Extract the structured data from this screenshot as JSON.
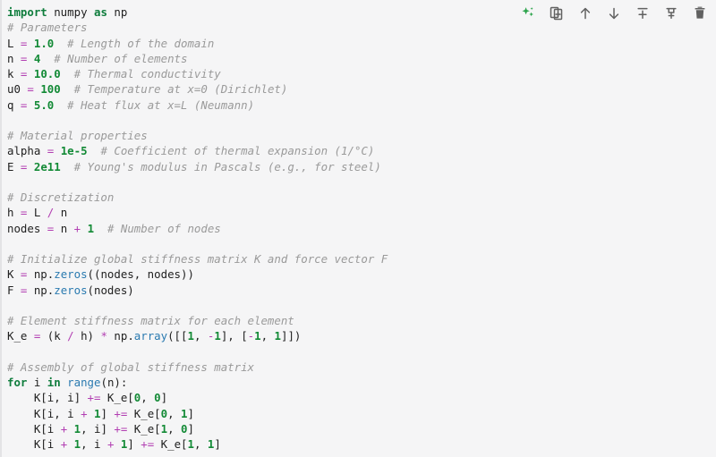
{
  "cell": {
    "type": "code-cell",
    "background_color": "#f5f5f6",
    "accent_bar_color": "#e3e3e5"
  },
  "toolbar": {
    "buttons": [
      {
        "name": "ai-assist-icon",
        "label": "Generate with AI",
        "color": "#2aa34a"
      },
      {
        "name": "duplicate-cell-icon",
        "label": "Duplicate cell",
        "color": "#616161"
      },
      {
        "name": "move-cell-up-icon",
        "label": "Move cell up",
        "color": "#616161"
      },
      {
        "name": "move-cell-down-icon",
        "label": "Move cell down",
        "color": "#616161"
      },
      {
        "name": "insert-cell-above-icon",
        "label": "Insert cell above",
        "color": "#616161"
      },
      {
        "name": "insert-cell-below-icon",
        "label": "Insert cell below",
        "color": "#616161"
      },
      {
        "name": "delete-cell-icon",
        "label": "Delete cell",
        "color": "#616161"
      }
    ]
  },
  "code": {
    "language": "python",
    "lines": [
      [
        {
          "t": "kw",
          "v": "import"
        },
        {
          "t": "nm",
          "v": " numpy "
        },
        {
          "t": "kw",
          "v": "as"
        },
        {
          "t": "nm",
          "v": " np"
        }
      ],
      [
        {
          "t": "com",
          "v": "# Parameters"
        }
      ],
      [
        {
          "t": "nm",
          "v": "L "
        },
        {
          "t": "op",
          "v": "="
        },
        {
          "t": "nm",
          "v": " "
        },
        {
          "t": "num",
          "v": "1.0"
        },
        {
          "t": "nm",
          "v": "  "
        },
        {
          "t": "com",
          "v": "# Length of the domain"
        }
      ],
      [
        {
          "t": "nm",
          "v": "n "
        },
        {
          "t": "op",
          "v": "="
        },
        {
          "t": "nm",
          "v": " "
        },
        {
          "t": "num",
          "v": "4"
        },
        {
          "t": "nm",
          "v": "  "
        },
        {
          "t": "com",
          "v": "# Number of elements"
        }
      ],
      [
        {
          "t": "nm",
          "v": "k "
        },
        {
          "t": "op",
          "v": "="
        },
        {
          "t": "nm",
          "v": " "
        },
        {
          "t": "num",
          "v": "10.0"
        },
        {
          "t": "nm",
          "v": "  "
        },
        {
          "t": "com",
          "v": "# Thermal conductivity"
        }
      ],
      [
        {
          "t": "nm",
          "v": "u0 "
        },
        {
          "t": "op",
          "v": "="
        },
        {
          "t": "nm",
          "v": " "
        },
        {
          "t": "num",
          "v": "100"
        },
        {
          "t": "nm",
          "v": "  "
        },
        {
          "t": "com",
          "v": "# Temperature at x=0 (Dirichlet)"
        }
      ],
      [
        {
          "t": "nm",
          "v": "q "
        },
        {
          "t": "op",
          "v": "="
        },
        {
          "t": "nm",
          "v": " "
        },
        {
          "t": "num",
          "v": "5.0"
        },
        {
          "t": "nm",
          "v": "  "
        },
        {
          "t": "com",
          "v": "# Heat flux at x=L (Neumann)"
        }
      ],
      [],
      [
        {
          "t": "com",
          "v": "# Material properties"
        }
      ],
      [
        {
          "t": "nm",
          "v": "alpha "
        },
        {
          "t": "op",
          "v": "="
        },
        {
          "t": "nm",
          "v": " "
        },
        {
          "t": "num",
          "v": "1e-5"
        },
        {
          "t": "nm",
          "v": "  "
        },
        {
          "t": "com",
          "v": "# Coefficient of thermal expansion (1/°C)"
        }
      ],
      [
        {
          "t": "nm",
          "v": "E "
        },
        {
          "t": "op",
          "v": "="
        },
        {
          "t": "nm",
          "v": " "
        },
        {
          "t": "num",
          "v": "2e11"
        },
        {
          "t": "nm",
          "v": "  "
        },
        {
          "t": "com",
          "v": "# Young's modulus in Pascals (e.g., for steel)"
        }
      ],
      [],
      [
        {
          "t": "com",
          "v": "# Discretization"
        }
      ],
      [
        {
          "t": "nm",
          "v": "h "
        },
        {
          "t": "op",
          "v": "="
        },
        {
          "t": "nm",
          "v": " L "
        },
        {
          "t": "op",
          "v": "/"
        },
        {
          "t": "nm",
          "v": " n"
        }
      ],
      [
        {
          "t": "nm",
          "v": "nodes "
        },
        {
          "t": "op",
          "v": "="
        },
        {
          "t": "nm",
          "v": " n "
        },
        {
          "t": "op",
          "v": "+"
        },
        {
          "t": "nm",
          "v": " "
        },
        {
          "t": "num",
          "v": "1"
        },
        {
          "t": "nm",
          "v": "  "
        },
        {
          "t": "com",
          "v": "# Number of nodes"
        }
      ],
      [],
      [
        {
          "t": "com",
          "v": "# Initialize global stiffness matrix K and force vector F"
        }
      ],
      [
        {
          "t": "nm",
          "v": "K "
        },
        {
          "t": "op",
          "v": "="
        },
        {
          "t": "nm",
          "v": " np."
        },
        {
          "t": "fn",
          "v": "zeros"
        },
        {
          "t": "nm",
          "v": "((nodes, nodes))"
        }
      ],
      [
        {
          "t": "nm",
          "v": "F "
        },
        {
          "t": "op",
          "v": "="
        },
        {
          "t": "nm",
          "v": " np."
        },
        {
          "t": "fn",
          "v": "zeros"
        },
        {
          "t": "nm",
          "v": "(nodes)"
        }
      ],
      [],
      [
        {
          "t": "com",
          "v": "# Element stiffness matrix for each element"
        }
      ],
      [
        {
          "t": "nm",
          "v": "K_e "
        },
        {
          "t": "op",
          "v": "="
        },
        {
          "t": "nm",
          "v": " (k "
        },
        {
          "t": "op",
          "v": "/"
        },
        {
          "t": "nm",
          "v": " h) "
        },
        {
          "t": "op",
          "v": "*"
        },
        {
          "t": "nm",
          "v": " np."
        },
        {
          "t": "fn",
          "v": "array"
        },
        {
          "t": "nm",
          "v": "([["
        },
        {
          "t": "num",
          "v": "1"
        },
        {
          "t": "nm",
          "v": ", "
        },
        {
          "t": "op",
          "v": "-"
        },
        {
          "t": "num",
          "v": "1"
        },
        {
          "t": "nm",
          "v": "], ["
        },
        {
          "t": "op",
          "v": "-"
        },
        {
          "t": "num",
          "v": "1"
        },
        {
          "t": "nm",
          "v": ", "
        },
        {
          "t": "num",
          "v": "1"
        },
        {
          "t": "nm",
          "v": "]])"
        }
      ],
      [],
      [
        {
          "t": "com",
          "v": "# Assembly of global stiffness matrix"
        }
      ],
      [
        {
          "t": "kw",
          "v": "for"
        },
        {
          "t": "nm",
          "v": " i "
        },
        {
          "t": "kw",
          "v": "in"
        },
        {
          "t": "nm",
          "v": " "
        },
        {
          "t": "fn",
          "v": "range"
        },
        {
          "t": "nm",
          "v": "(n):"
        }
      ],
      [
        {
          "t": "nm",
          "v": "    K[i, i] "
        },
        {
          "t": "op",
          "v": "+="
        },
        {
          "t": "nm",
          "v": " K_e["
        },
        {
          "t": "num",
          "v": "0"
        },
        {
          "t": "nm",
          "v": ", "
        },
        {
          "t": "num",
          "v": "0"
        },
        {
          "t": "nm",
          "v": "]"
        }
      ],
      [
        {
          "t": "nm",
          "v": "    K[i, i "
        },
        {
          "t": "op",
          "v": "+"
        },
        {
          "t": "nm",
          "v": " "
        },
        {
          "t": "num",
          "v": "1"
        },
        {
          "t": "nm",
          "v": "] "
        },
        {
          "t": "op",
          "v": "+="
        },
        {
          "t": "nm",
          "v": " K_e["
        },
        {
          "t": "num",
          "v": "0"
        },
        {
          "t": "nm",
          "v": ", "
        },
        {
          "t": "num",
          "v": "1"
        },
        {
          "t": "nm",
          "v": "]"
        }
      ],
      [
        {
          "t": "nm",
          "v": "    K[i "
        },
        {
          "t": "op",
          "v": "+"
        },
        {
          "t": "nm",
          "v": " "
        },
        {
          "t": "num",
          "v": "1"
        },
        {
          "t": "nm",
          "v": ", i] "
        },
        {
          "t": "op",
          "v": "+="
        },
        {
          "t": "nm",
          "v": " K_e["
        },
        {
          "t": "num",
          "v": "1"
        },
        {
          "t": "nm",
          "v": ", "
        },
        {
          "t": "num",
          "v": "0"
        },
        {
          "t": "nm",
          "v": "]"
        }
      ],
      [
        {
          "t": "nm",
          "v": "    K[i "
        },
        {
          "t": "op",
          "v": "+"
        },
        {
          "t": "nm",
          "v": " "
        },
        {
          "t": "num",
          "v": "1"
        },
        {
          "t": "nm",
          "v": ", i "
        },
        {
          "t": "op",
          "v": "+"
        },
        {
          "t": "nm",
          "v": " "
        },
        {
          "t": "num",
          "v": "1"
        },
        {
          "t": "nm",
          "v": "] "
        },
        {
          "t": "op",
          "v": "+="
        },
        {
          "t": "nm",
          "v": " K_e["
        },
        {
          "t": "num",
          "v": "1"
        },
        {
          "t": "nm",
          "v": ", "
        },
        {
          "t": "num",
          "v": "1"
        },
        {
          "t": "nm",
          "v": "]"
        }
      ]
    ]
  },
  "syntax_colors": {
    "keyword": "#0f7d3d",
    "comment": "#9a9a9a",
    "operator": "#b23fb2",
    "number": "#138a36",
    "function": "#2a7ab0",
    "plain": "#212121"
  }
}
